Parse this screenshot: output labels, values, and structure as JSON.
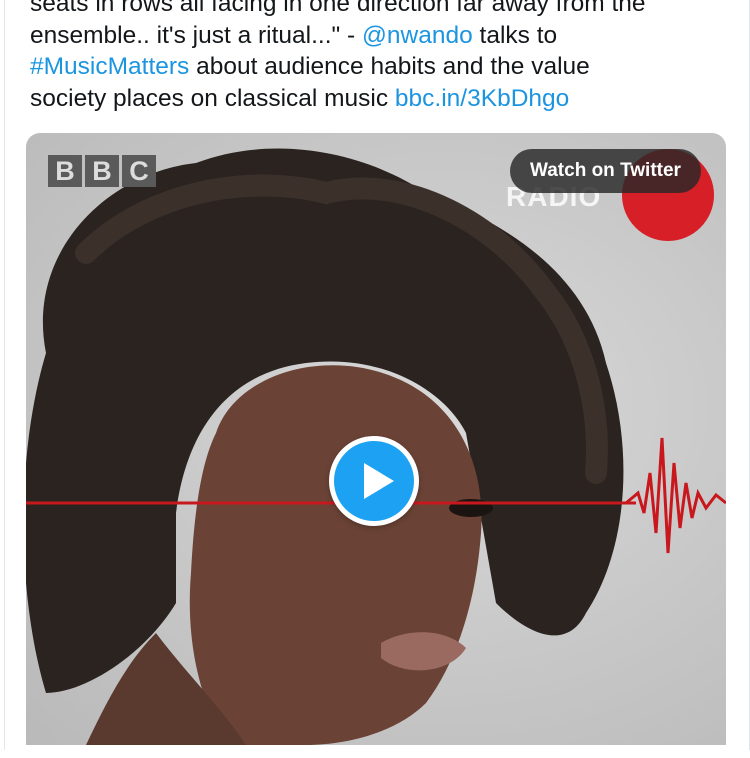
{
  "tweet": {
    "line1": "seats in rows all facing in one direction far away from the",
    "line2_text": "ensemble.. it's just a ritual...\" - ",
    "line2_mention": "@nwando",
    "line2_tail": " talks to",
    "line3_hashtag": "#MusicMatters",
    "line3_tail": " about audience habits and the value",
    "line4_text": "society places on classical music ",
    "line4_link": "bbc.in/3KbDhgo"
  },
  "media": {
    "bbc_letters": [
      "B",
      "B",
      "C"
    ],
    "radio_label": "RADIO",
    "watch_label": "Watch on Twitter",
    "play_icon": "play-icon"
  },
  "colors": {
    "link": "#1b95e0",
    "play_button": "#1da1f2",
    "radio3_red": "#d61f26",
    "waveform": "#c8181e"
  }
}
